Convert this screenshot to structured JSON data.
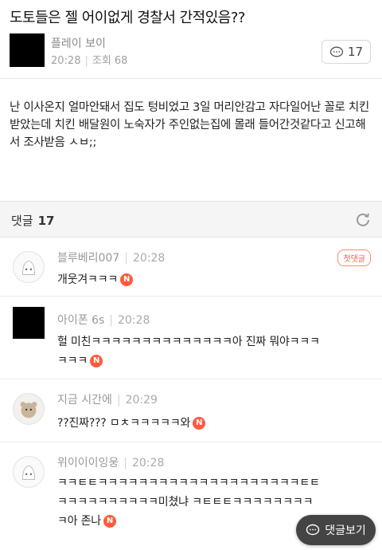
{
  "post": {
    "title": "도토들은 젤 어이없게 경찰서 간적있음??",
    "author": "플레이 보이",
    "time": "20:28",
    "views_label": "조회 68",
    "comment_count": "17",
    "body": "난 이사온지 얼마안돼서 집도 텅비었고 3일 머리안감고 자다일어난 꼴로 치킨 받았는데 치킨 배달원이 노숙자가 주인없는집에 몰래 들어간것같다고 신고해서 조사받음 ㅅㅂ;;"
  },
  "comments_header": {
    "label": "댓글",
    "count": "17"
  },
  "comments": [
    {
      "name": "블루베리007",
      "time": "20:28",
      "text": "개웃겨ㅋㅋㅋ",
      "badge": "N",
      "first_label": "첫댓글"
    },
    {
      "name": "아이폰 6s",
      "time": "20:28",
      "text_line1": "헐 미친ㅋㅋㅋㅋㅋㅋㅋㅋㅋㅋㅋㅋㅋㅋ아 진짜 뭐야ㅋㅋㅋ",
      "text_line2": "ㅋㅋㅋ",
      "badge": "N"
    },
    {
      "name": "지금 시간에",
      "time": "20:29",
      "text": "??진짜??? ㅁㅊㅋㅋㅋㅋㅋ와",
      "badge": "N"
    },
    {
      "name": "위이이이잉웅",
      "time": "20:28",
      "text_line1": "ㅋㅋㅌㅌㅋㅋㅋㅋㅋㅋㅋㅋㅋㅋㅋㅋㅋㅋㅋㅋㅋㅋㅋㅋㅌㅌ",
      "text_line2": "ㅋㅋㅋㅋㅋㅋㅋㅋㅋㅋ미쳤냐 ㅋㅌㅌㅌㅋㅋㅋㅋㅋㅋㅋㅋ",
      "text_line3": "ㅋ아 존나",
      "badge": "N"
    }
  ],
  "reply_button": {
    "label": "댓글보기"
  },
  "colors": {
    "accent": "#ff5a3c",
    "fab": "#444444"
  }
}
